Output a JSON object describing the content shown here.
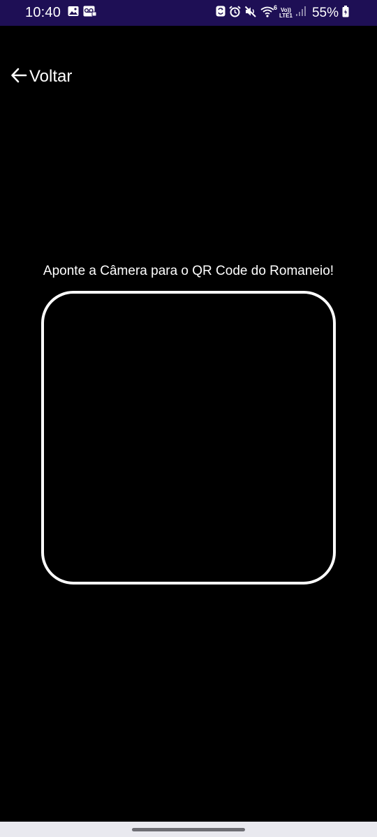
{
  "status_bar": {
    "time": "10:40",
    "left_icons": [
      "image-icon",
      "voicemail-icon"
    ],
    "right_icons": [
      "sync-icon",
      "alarm-icon",
      "mute-icon",
      "wifi-icon",
      "volte-icon",
      "signal-icon",
      "battery-icon"
    ],
    "wifi_badge": "6",
    "volte_label_top": "Vo))",
    "volte_label_bottom": "LTE1",
    "battery_percent": "55%",
    "background_color": "#1e0f55"
  },
  "header": {
    "back_label": "Voltar"
  },
  "scanner": {
    "instruction": "Aponte a Câmera para o QR Code do Romaneio!",
    "frame_color": "#ffffff"
  }
}
